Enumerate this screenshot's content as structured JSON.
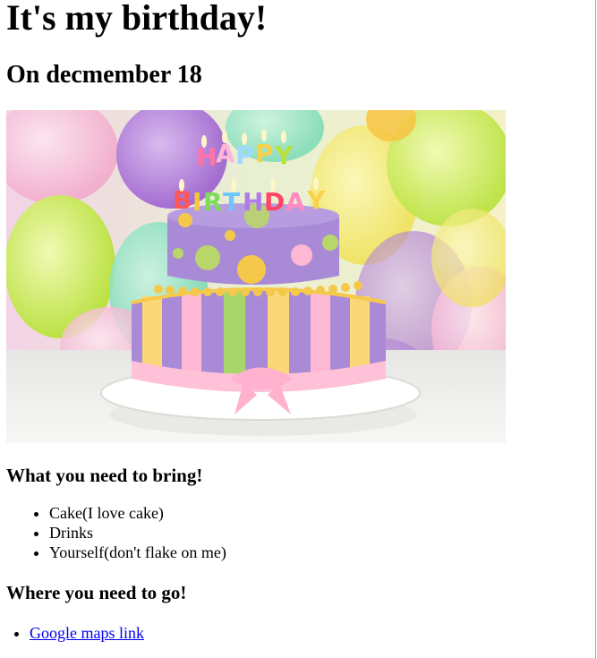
{
  "page": {
    "title": "It's my birthday!",
    "subtitle": "On decmember 18"
  },
  "hero_image": {
    "subject": "birthday-cake-with-candles",
    "candle_text_top": "HAPPY",
    "candle_text_bottom": "BIRTHDAY"
  },
  "bring_section": {
    "heading": "What you need to bring!",
    "items": [
      "Cake(I love cake)",
      "Drinks",
      "Yourself(don't flake on me)"
    ]
  },
  "where_section": {
    "heading": "Where you need to go!",
    "link_text": "Google maps link"
  }
}
